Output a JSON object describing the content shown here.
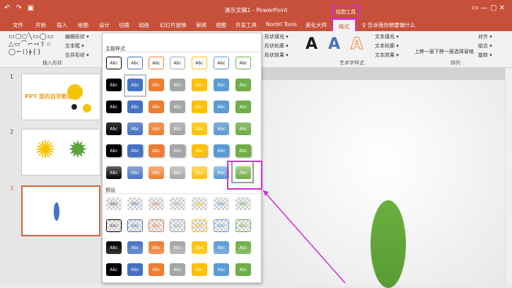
{
  "qat": {
    "undo": "↶",
    "redo": "↷",
    "save": "▣"
  },
  "window": {
    "title": "演示文稿1 - PowerPoint",
    "contextual_tab_group": "绘图工具",
    "buttons": "▭  —  ▢  ✕"
  },
  "tabs": [
    "文件",
    "开始",
    "插入",
    "绘图",
    "设计",
    "切换",
    "动画",
    "幻灯片放映",
    "审阅",
    "视图",
    "开发工具",
    "Nordri Tools",
    "美化大师"
  ],
  "active_tab": "格式",
  "tellme": "♀ 告诉我你想要做什么",
  "ribbon": {
    "insert_shapes": {
      "label": "插入形状",
      "edit_shape": "编辑形状 ▾",
      "textbox": "文本框 ▾",
      "merge_shapes": "合并形状 ▾"
    },
    "shape_style": {
      "fill": "形状填充 ▾",
      "outline": "形状轮廓 ▾",
      "effects": "形状效果 ▾"
    },
    "wordart": {
      "label": "艺术字样式",
      "letters": [
        "A",
        "A",
        "A"
      ],
      "text_fill": "文本填充 ▾",
      "text_outline": "文本轮廓 ▾",
      "text_effects": "文本效果 ▾"
    },
    "arrange": {
      "label": "排列",
      "bring_forward": "上移一层",
      "send_backward": "下移一层",
      "selection_pane": "选择窗格",
      "align": "对齐 ▾",
      "group": "组合 ▾",
      "rotate": "旋转 ▾"
    }
  },
  "gallery": {
    "theme_label": "主题样式",
    "preset_label": "预设",
    "btn_text": "Abc",
    "colors": [
      "#000000",
      "#4472c4",
      "#ed7d31",
      "#a5a5a5",
      "#ffc000",
      "#5b9bd5",
      "#70ad47"
    ]
  },
  "slides": [
    {
      "number": "1",
      "title": "PPT 里的自学教程"
    },
    {
      "number": "2"
    },
    {
      "number": "3"
    }
  ]
}
